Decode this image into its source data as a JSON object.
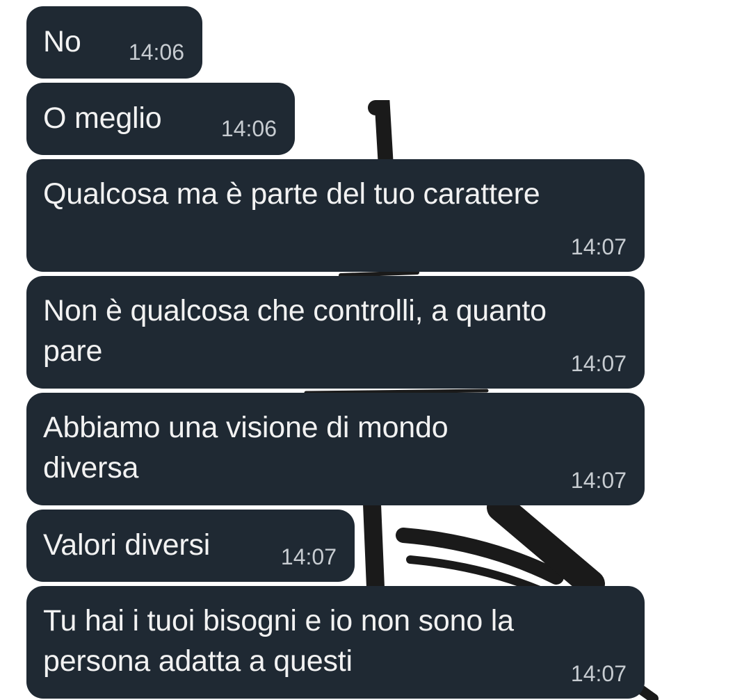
{
  "colors": {
    "bubble_background": "#1f2933",
    "message_text": "#f2f2f2",
    "timestamp_text": "#c7ccd1",
    "wallpaper": "#ffffff",
    "wallpaper_art": "#1a1a1a"
  },
  "messages": [
    {
      "text": "No",
      "time": "14:06"
    },
    {
      "text": "O meglio",
      "time": "14:06"
    },
    {
      "text": "Qualcosa ma è parte del tuo carattere",
      "time": "14:07"
    },
    {
      "text": "Non è qualcosa che controlli, a quanto\npare",
      "time": "14:07"
    },
    {
      "text": "Abbiamo una visione di mondo\ndiversa",
      "time": "14:07"
    },
    {
      "text": "Valori diversi",
      "time": "14:07"
    },
    {
      "text": "Tu hai i tuoi bisogni e io non sono la\npersona adatta a questi",
      "time": "14:07"
    }
  ]
}
